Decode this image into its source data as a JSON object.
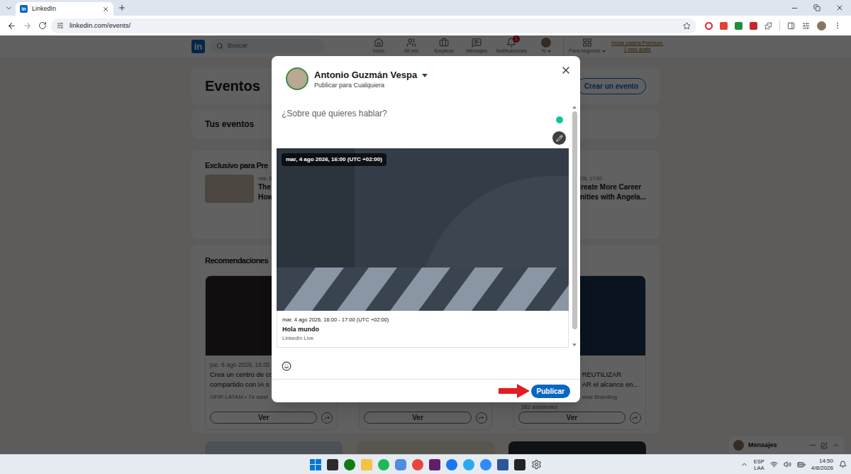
{
  "browser": {
    "tab": {
      "title": "LinkedIn",
      "logo": "in",
      "selected": true
    },
    "url": "linkedin.com/events/"
  },
  "nav": {
    "logo": "in",
    "search": {
      "placeholder": "Buscar"
    },
    "items": [
      {
        "label": "Inicio",
        "kind": "icon",
        "selected": false
      },
      {
        "label": "Mi red",
        "kind": "icon",
        "selected": false
      },
      {
        "label": "Empleos",
        "kind": "icon",
        "selected": false
      },
      {
        "label": "Mensajes",
        "kind": "icon",
        "selected": false
      },
      {
        "label": "Notificaciones",
        "kind": "icon",
        "badge": "1",
        "selected": false
      },
      {
        "label": "Yo",
        "kind": "avatar",
        "selected": false
      },
      {
        "label": "Para negocios",
        "kind": "menu",
        "selected": false
      }
    ],
    "premium": [
      "Iniciar página Premium:",
      "1 mes gratis"
    ]
  },
  "page": {
    "header": {
      "title": "Eventos",
      "button": "Crear un evento"
    },
    "your_events": {
      "title": "Tus eventos"
    },
    "premium_section": {
      "title": "Exclusivo para Pre",
      "cards": [
        {
          "date": "mié, 5",
          "lines": [
            "The",
            "How"
          ]
        },
        {
          "date": "2026, 17:00",
          "lines": [
            "Create More Career",
            "unities with Angela..."
          ]
        }
      ]
    },
    "recommendations": {
      "title": "Recomendaciones",
      "cards": [
        {
          "kind": "covered-right",
          "date": "jue. 6 ago 2026, 16:00",
          "title": [
            "Crea un centro de co",
            "compartido con IA s"
          ],
          "meta": [
            "OFIR LATAM • 74 asist"
          ],
          "button": "Ver"
        },
        {
          "kind": "covered",
          "title": [],
          "meta": [],
          "button": "Ver"
        },
        {
          "kind": "covered-left",
          "title": [
            "REUTILIZAR",
            "AR el alcance en..."
          ],
          "meta": [
            "onal Branding",
            "282 asistentes"
          ],
          "button": "Ver"
        }
      ]
    },
    "messaging": {
      "label": "Mensajes"
    }
  },
  "dialog": {
    "author": "Antonio Guzmán Vespa",
    "audience": "Publicar para Cualquiera",
    "placeholder": "¿Sobre qué quieres hablar?",
    "event": {
      "badge": "mar, 4 ago 2026, 16:00 (UTC +02:00)",
      "time": "mar, 4 ago 2026, 16:00 - 17:00 (UTC +02:00)",
      "title": "Hola mundo",
      "type": "LinkedIn Live"
    },
    "scrollbar": {
      "level": 0.95
    },
    "submit": {
      "label": "Publicar",
      "disabled": false
    }
  },
  "taskbar": {
    "language": [
      "ESP",
      "LAA"
    ],
    "time": "14:50",
    "date": "4/8/2026"
  }
}
